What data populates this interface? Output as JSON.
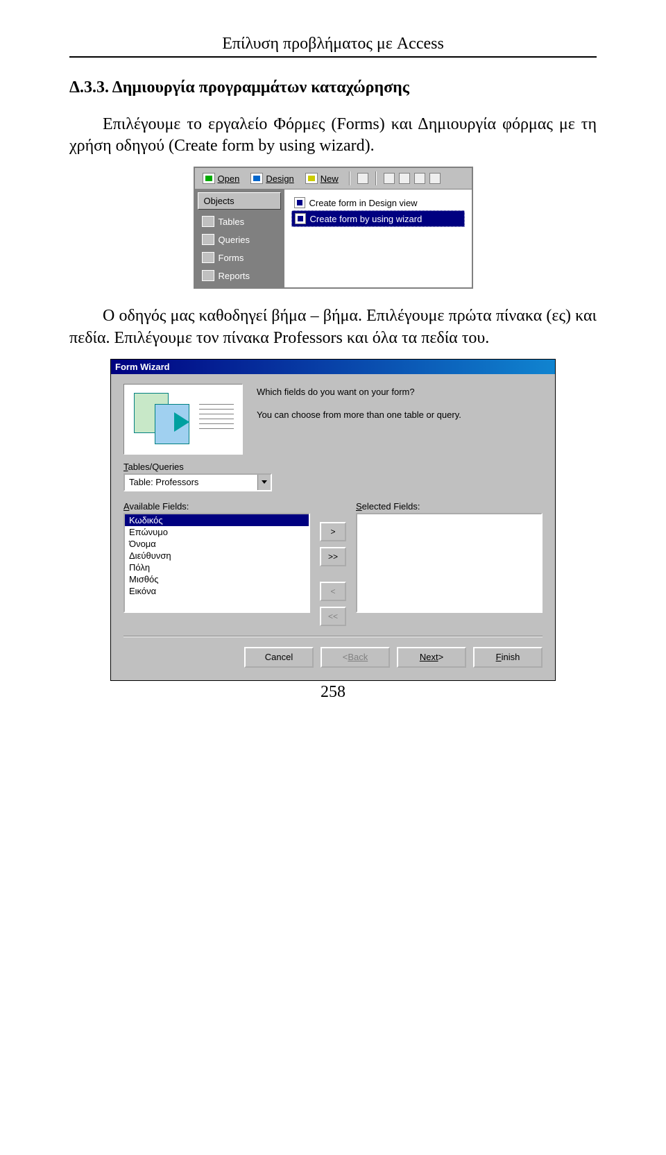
{
  "header": "Επίλυση προβλήματος με Access",
  "section_title": "Δ.3.3. Δημιουργία προγραμμάτων καταχώρησης",
  "para1": "Επιλέγουμε το εργαλείο Φόρμες (Forms) και Δημιουργία φόρμας με τη χρήση οδηγού (Create form by using wizard).",
  "para2_a": "Ο οδηγός μας καθοδηγεί βήμα – βήμα. Επιλέγουμε πρώτα πίνακα (ες) και πεδία. Επιλέγουμε τον πίνακα Professors και όλα τα πεδία του.",
  "page_number": "258",
  "access": {
    "toolbar": {
      "open": "Open",
      "design": "Design",
      "new": "New"
    },
    "sidebar_header": "Objects",
    "sidebar": [
      "Tables",
      "Queries",
      "Forms",
      "Reports"
    ],
    "list": {
      "item1": "Create form in Design view",
      "item2": "Create form by using wizard"
    }
  },
  "wizard": {
    "title": "Form Wizard",
    "q1": "Which fields do you want on your form?",
    "q2": "You can choose from more than one table or query.",
    "tables_label": "Tables/Queries",
    "combo_value": "Table: Professors",
    "avail_label": "Available Fields:",
    "sel_label": "Selected Fields:",
    "available": [
      "Κωδικός",
      "Επώνυμο",
      "Όνομα",
      "Διεύθυνση",
      "Πόλη",
      "Μισθός",
      "Εικόνα"
    ],
    "move": {
      "add": ">",
      "addall": ">>",
      "rem": "<",
      "remall": "<<"
    },
    "buttons": {
      "cancel": "Cancel",
      "back_lt": "< ",
      "back": "Back",
      "next": "Next",
      "next_gt": " >",
      "finish": "Finish"
    }
  }
}
